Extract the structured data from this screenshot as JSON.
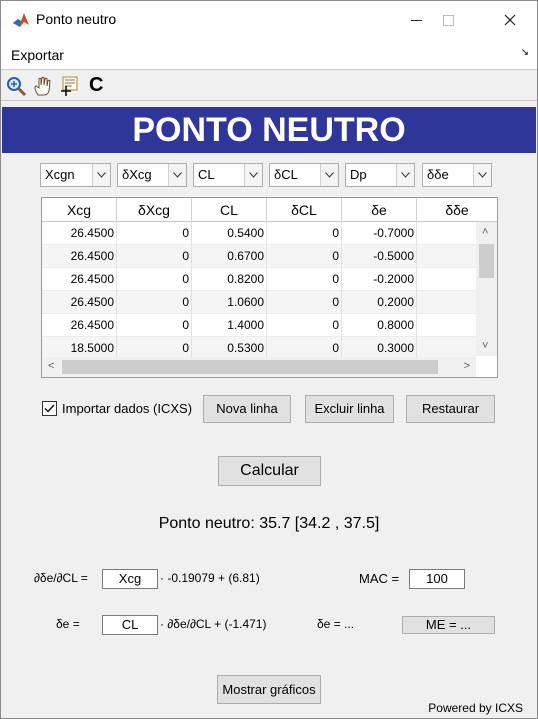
{
  "window": {
    "title": "Ponto neutro"
  },
  "menu": {
    "export": "Exportar",
    "corner": "↘"
  },
  "toolbar": {
    "icons": [
      "zoom-in-icon",
      "pan-hand-icon",
      "data-cursor-icon",
      "c-icon"
    ],
    "c_label": "C"
  },
  "banner": {
    "title": "PONTO NEUTRO",
    "color": "#2f3699"
  },
  "dropdowns": [
    "Xcgn",
    "δXcg",
    "CL",
    "δCL",
    "Dp",
    "δδe"
  ],
  "table": {
    "headers": [
      "Xcg",
      "δXcg",
      "CL",
      "δCL",
      "δe",
      "δδe"
    ],
    "rows": [
      [
        "26.4500",
        "0",
        "0.5400",
        "0",
        "-0.7000",
        ""
      ],
      [
        "26.4500",
        "0",
        "0.6700",
        "0",
        "-0.5000",
        ""
      ],
      [
        "26.4500",
        "0",
        "0.8200",
        "0",
        "-0.2000",
        ""
      ],
      [
        "26.4500",
        "0",
        "1.0600",
        "0",
        "0.2000",
        ""
      ],
      [
        "26.4500",
        "0",
        "1.4000",
        "0",
        "0.8000",
        ""
      ],
      [
        "18.5000",
        "0",
        "0.5300",
        "0",
        "0.3000",
        ""
      ]
    ]
  },
  "controls": {
    "import_label": "Importar dados (ICXS)",
    "import_checked": true,
    "new_row": "Nova linha",
    "delete_row": "Excluir linha",
    "restore": "Restaurar",
    "calculate": "Calcular"
  },
  "result": {
    "neutral_point": "Ponto neutro: 35.7 [34.2 , 37.5]"
  },
  "equations": {
    "de_dcl_label": "∂δe/∂CL =",
    "xcg_field": "Xcg",
    "de_dcl_expr": "· -0.19079 + (6.81)",
    "mac_label": "MAC =",
    "mac_value": "100",
    "de_label": "δe =",
    "cl_field": "CL",
    "de_expr": "· ∂δe/∂CL + (-1.471)",
    "de_equals": "δe = ...",
    "me_button": "ME = ..."
  },
  "footer": {
    "show_graphs": "Mostrar gráficos",
    "powered": "Powered by ICXS"
  }
}
